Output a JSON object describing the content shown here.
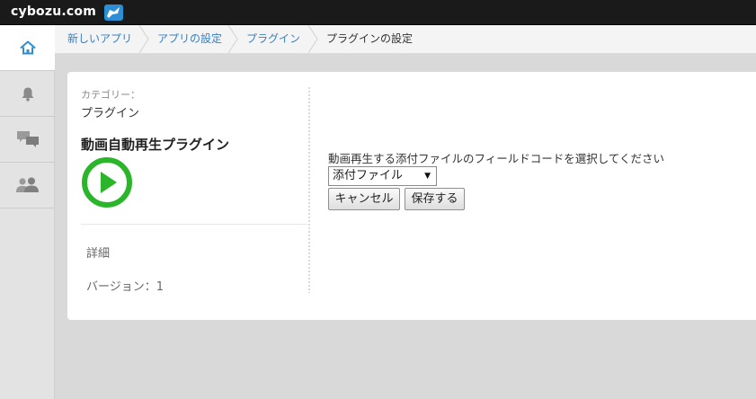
{
  "header": {
    "logo_text": "cybozu.com",
    "app_icon": "kintone-app-icon"
  },
  "sidebar": {
    "items": [
      {
        "name": "home",
        "icon": "home-icon",
        "active": true
      },
      {
        "name": "notifications",
        "icon": "bell-icon",
        "active": false
      },
      {
        "name": "messages",
        "icon": "speech-bubbles-icon",
        "active": false
      },
      {
        "name": "people",
        "icon": "people-icon",
        "active": false
      }
    ]
  },
  "breadcrumb": {
    "items": [
      "新しいアプリ",
      "アプリの設定",
      "プラグイン"
    ],
    "current": "プラグインの設定"
  },
  "plugin": {
    "category_label": "カテゴリー：",
    "category_value": "プラグイン",
    "name": "動画自動再生プラグイン",
    "icon": "play-circle-icon",
    "detail_link": "詳細",
    "version_text": "バージョン：1"
  },
  "settings": {
    "field_label": "動画再生する添付ファイルのフィールドコードを選択してください",
    "select_value": "添付ファイル",
    "cancel_label": "キャンセル",
    "save_label": "保存する"
  },
  "colors": {
    "accent_link": "#3a7fc1",
    "play_green": "#2bb52b",
    "topbar": "#1a1a1a"
  }
}
